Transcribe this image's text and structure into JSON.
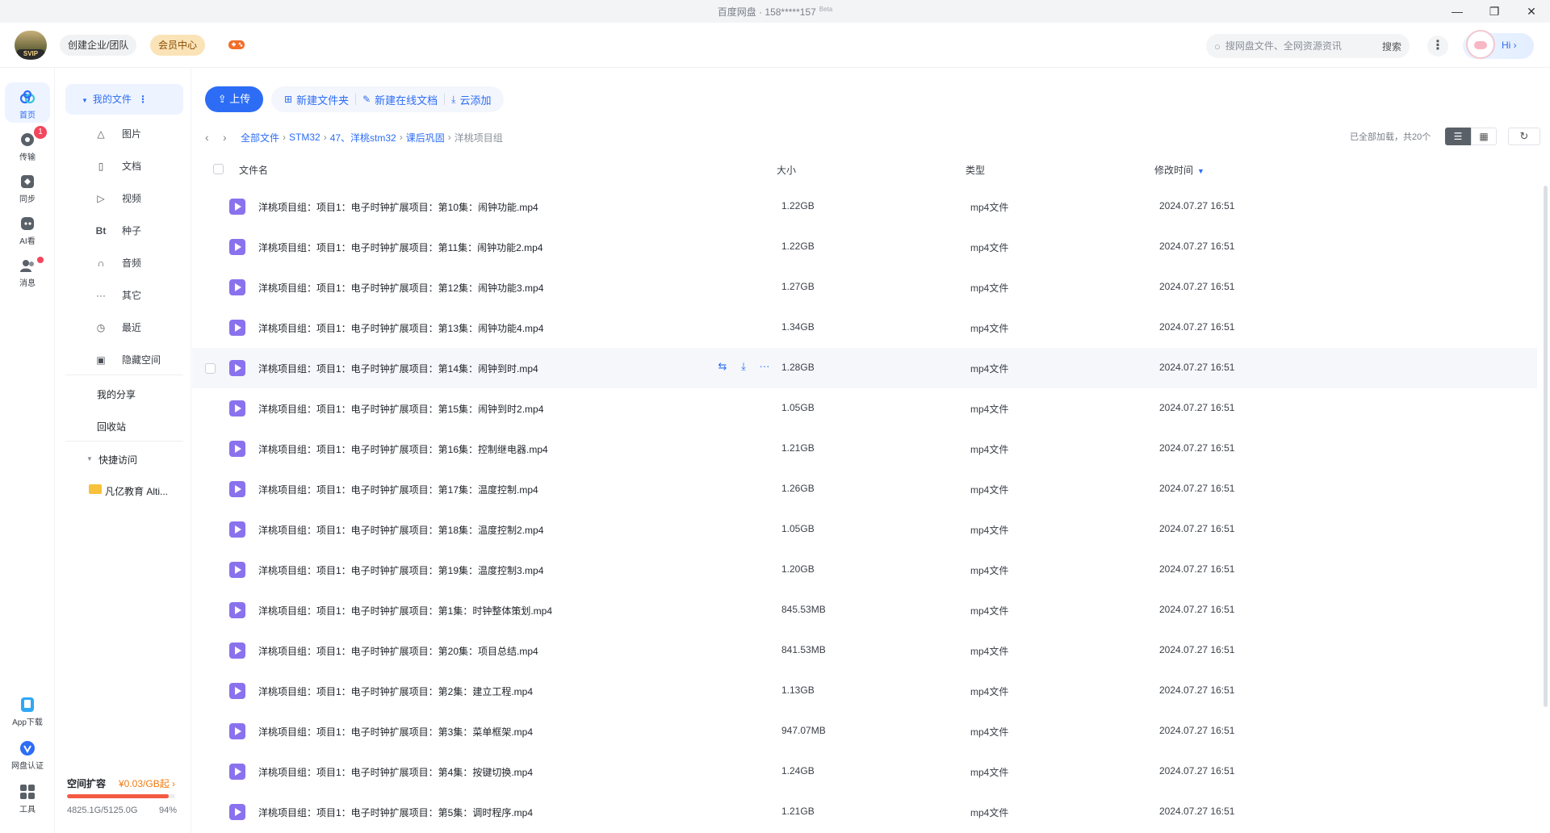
{
  "window": {
    "title": "百度网盘 · 158*****157",
    "beta": "Beta"
  },
  "header": {
    "team_label": "创建企业/团队",
    "vip_label": "会员中心",
    "search_placeholder": "搜网盘文件、全网资源资讯",
    "search_button": "搜索",
    "hi_label": "Hi ›"
  },
  "rail": [
    {
      "label": "首页",
      "icon": "cloud-icon"
    },
    {
      "label": "传输",
      "icon": "transfer-icon",
      "badge": "1"
    },
    {
      "label": "同步",
      "icon": "sync-icon"
    },
    {
      "label": "AI看",
      "icon": "ai-icon"
    },
    {
      "label": "消息",
      "icon": "message-icon"
    },
    {
      "label": "App下载",
      "icon": "phone-icon"
    },
    {
      "label": "网盘认证",
      "icon": "verify-icon"
    },
    {
      "label": "工具",
      "icon": "grid-icon"
    }
  ],
  "sidebar": {
    "my_files": "我的文件",
    "items": [
      {
        "label": "图片",
        "icon": "image-icon"
      },
      {
        "label": "文档",
        "icon": "document-icon"
      },
      {
        "label": "视频",
        "icon": "video-icon"
      },
      {
        "label": "种子",
        "icon": "bt-icon"
      },
      {
        "label": "音频",
        "icon": "headphone-icon"
      },
      {
        "label": "其它",
        "icon": "more-icon"
      },
      {
        "label": "最近",
        "icon": "clock-icon"
      },
      {
        "label": "隐藏空间",
        "icon": "lock-icon"
      }
    ],
    "my_share": "我的分享",
    "recycle": "回收站",
    "quick_access": "快捷访问",
    "quick_folder": "凡亿教育 Alti...",
    "quota": {
      "label": "空间扩容",
      "price": "¥0.03/GB起 ›",
      "used": "4825.1G/5125.0G",
      "percent": "94%",
      "fill_fraction": 0.94
    }
  },
  "toolbar": {
    "upload": "上传",
    "new_folder": "新建文件夹",
    "new_doc": "新建在线文档",
    "cloud_add": "云添加"
  },
  "breadcrumb": {
    "items": [
      "全部文件",
      "STM32",
      "47、洋桃stm32",
      "课后巩固"
    ],
    "current": "洋桃项目组",
    "loaded": "已全部加载，共20个"
  },
  "table": {
    "headers": {
      "name": "文件名",
      "size": "大小",
      "type": "类型",
      "time": "修改时间"
    },
    "rows": [
      {
        "name": "洋桃项目组：项目1：电子时钟扩展项目：第10集：闹钟功能.mp4",
        "size": "1.22GB",
        "type": "mp4文件",
        "time": "2024.07.27 16:51"
      },
      {
        "name": "洋桃项目组：项目1：电子时钟扩展项目：第11集：闹钟功能2.mp4",
        "size": "1.22GB",
        "type": "mp4文件",
        "time": "2024.07.27 16:51"
      },
      {
        "name": "洋桃项目组：项目1：电子时钟扩展项目：第12集：闹钟功能3.mp4",
        "size": "1.27GB",
        "type": "mp4文件",
        "time": "2024.07.27 16:51"
      },
      {
        "name": "洋桃项目组：项目1：电子时钟扩展项目：第13集：闹钟功能4.mp4",
        "size": "1.34GB",
        "type": "mp4文件",
        "time": "2024.07.27 16:51"
      },
      {
        "name": "洋桃项目组：项目1：电子时钟扩展项目：第14集：闹钟到时.mp4",
        "size": "1.28GB",
        "type": "mp4文件",
        "time": "2024.07.27 16:51",
        "hover": true
      },
      {
        "name": "洋桃项目组：项目1：电子时钟扩展项目：第15集：闹钟到时2.mp4",
        "size": "1.05GB",
        "type": "mp4文件",
        "time": "2024.07.27 16:51"
      },
      {
        "name": "洋桃项目组：项目1：电子时钟扩展项目：第16集：控制继电器.mp4",
        "size": "1.21GB",
        "type": "mp4文件",
        "time": "2024.07.27 16:51"
      },
      {
        "name": "洋桃项目组：项目1：电子时钟扩展项目：第17集：温度控制.mp4",
        "size": "1.26GB",
        "type": "mp4文件",
        "time": "2024.07.27 16:51"
      },
      {
        "name": "洋桃项目组：项目1：电子时钟扩展项目：第18集：温度控制2.mp4",
        "size": "1.05GB",
        "type": "mp4文件",
        "time": "2024.07.27 16:51"
      },
      {
        "name": "洋桃项目组：项目1：电子时钟扩展项目：第19集：温度控制3.mp4",
        "size": "1.20GB",
        "type": "mp4文件",
        "time": "2024.07.27 16:51"
      },
      {
        "name": "洋桃项目组：项目1：电子时钟扩展项目：第1集：时钟整体策划.mp4",
        "size": "845.53MB",
        "type": "mp4文件",
        "time": "2024.07.27 16:51"
      },
      {
        "name": "洋桃项目组：项目1：电子时钟扩展项目：第20集：项目总结.mp4",
        "size": "841.53MB",
        "type": "mp4文件",
        "time": "2024.07.27 16:51"
      },
      {
        "name": "洋桃项目组：项目1：电子时钟扩展项目：第2集：建立工程.mp4",
        "size": "1.13GB",
        "type": "mp4文件",
        "time": "2024.07.27 16:51"
      },
      {
        "name": "洋桃项目组：项目1：电子时钟扩展项目：第3集：菜单框架.mp4",
        "size": "947.07MB",
        "type": "mp4文件",
        "time": "2024.07.27 16:51"
      },
      {
        "name": "洋桃项目组：项目1：电子时钟扩展项目：第4集：按键切换.mp4",
        "size": "1.24GB",
        "type": "mp4文件",
        "time": "2024.07.27 16:51"
      },
      {
        "name": "洋桃项目组：项目1：电子时钟扩展项目：第5集：调时程序.mp4",
        "size": "1.21GB",
        "type": "mp4文件",
        "time": "2024.07.27 16:51"
      }
    ]
  },
  "colors": {
    "accent": "#2d6df6",
    "file_icon": "#8a72ee",
    "badge": "#f5455c",
    "quota_fill": "#f25a42"
  }
}
